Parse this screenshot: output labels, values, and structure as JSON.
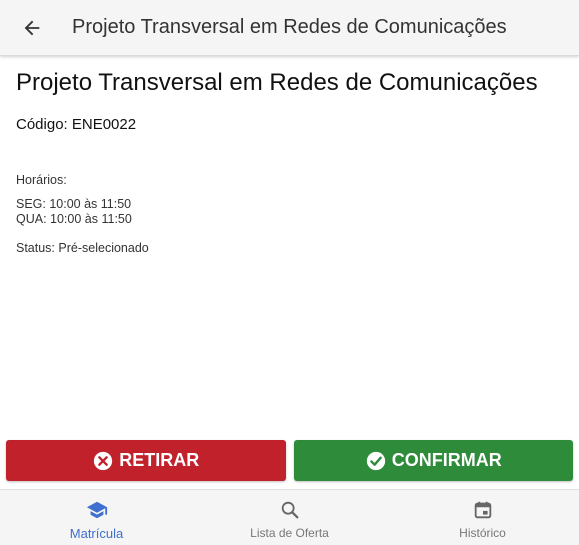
{
  "header": {
    "title": "Projeto Transversal em Redes de Comunicações",
    "back_icon": "arrow-back-icon"
  },
  "course": {
    "title": "Projeto Transversal em Redes de Comunicações",
    "code_label": "Código:",
    "code_value": "ENE0022",
    "schedule_label": "Horários:",
    "schedule": [
      "SEG: 10:00 às 11:50",
      "QUA: 10:00 às 11:50"
    ],
    "status_label": "Status:",
    "status_value": "Pré-selecionado"
  },
  "actions": {
    "remove_label": "RETIRAR",
    "remove_icon": "close-circle-icon",
    "remove_color": "#c0212b",
    "confirm_label": "CONFIRMAR",
    "confirm_icon": "check-circle-icon",
    "confirm_color": "#2e8b3a"
  },
  "bottom_nav": {
    "items": [
      {
        "label": "Matrícula",
        "icon": "graduation-cap-icon",
        "active": true
      },
      {
        "label": "Lista de Oferta",
        "icon": "search-icon",
        "active": false
      },
      {
        "label": "Histórico",
        "icon": "calendar-icon",
        "active": false
      }
    ],
    "active_color": "#3f6fcf"
  }
}
